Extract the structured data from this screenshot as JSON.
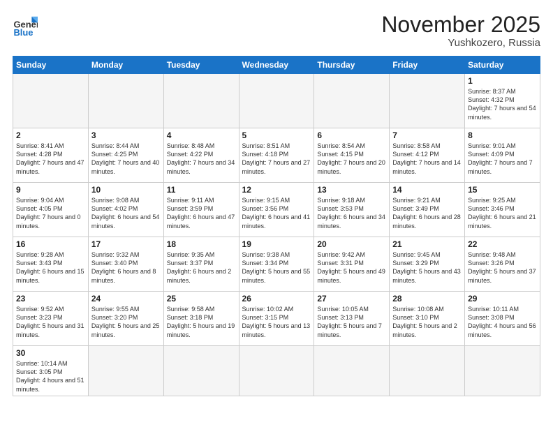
{
  "header": {
    "logo_general": "General",
    "logo_blue": "Blue",
    "month_title": "November 2025",
    "location": "Yushkozero, Russia"
  },
  "weekdays": [
    "Sunday",
    "Monday",
    "Tuesday",
    "Wednesday",
    "Thursday",
    "Friday",
    "Saturday"
  ],
  "weeks": [
    [
      {
        "day": "",
        "info": ""
      },
      {
        "day": "",
        "info": ""
      },
      {
        "day": "",
        "info": ""
      },
      {
        "day": "",
        "info": ""
      },
      {
        "day": "",
        "info": ""
      },
      {
        "day": "",
        "info": ""
      },
      {
        "day": "1",
        "info": "Sunrise: 8:37 AM\nSunset: 4:32 PM\nDaylight: 7 hours\nand 54 minutes."
      }
    ],
    [
      {
        "day": "2",
        "info": "Sunrise: 8:41 AM\nSunset: 4:28 PM\nDaylight: 7 hours\nand 47 minutes."
      },
      {
        "day": "3",
        "info": "Sunrise: 8:44 AM\nSunset: 4:25 PM\nDaylight: 7 hours\nand 40 minutes."
      },
      {
        "day": "4",
        "info": "Sunrise: 8:48 AM\nSunset: 4:22 PM\nDaylight: 7 hours\nand 34 minutes."
      },
      {
        "day": "5",
        "info": "Sunrise: 8:51 AM\nSunset: 4:18 PM\nDaylight: 7 hours\nand 27 minutes."
      },
      {
        "day": "6",
        "info": "Sunrise: 8:54 AM\nSunset: 4:15 PM\nDaylight: 7 hours\nand 20 minutes."
      },
      {
        "day": "7",
        "info": "Sunrise: 8:58 AM\nSunset: 4:12 PM\nDaylight: 7 hours\nand 14 minutes."
      },
      {
        "day": "8",
        "info": "Sunrise: 9:01 AM\nSunset: 4:09 PM\nDaylight: 7 hours\nand 7 minutes."
      }
    ],
    [
      {
        "day": "9",
        "info": "Sunrise: 9:04 AM\nSunset: 4:05 PM\nDaylight: 7 hours\nand 0 minutes."
      },
      {
        "day": "10",
        "info": "Sunrise: 9:08 AM\nSunset: 4:02 PM\nDaylight: 6 hours\nand 54 minutes."
      },
      {
        "day": "11",
        "info": "Sunrise: 9:11 AM\nSunset: 3:59 PM\nDaylight: 6 hours\nand 47 minutes."
      },
      {
        "day": "12",
        "info": "Sunrise: 9:15 AM\nSunset: 3:56 PM\nDaylight: 6 hours\nand 41 minutes."
      },
      {
        "day": "13",
        "info": "Sunrise: 9:18 AM\nSunset: 3:53 PM\nDaylight: 6 hours\nand 34 minutes."
      },
      {
        "day": "14",
        "info": "Sunrise: 9:21 AM\nSunset: 3:49 PM\nDaylight: 6 hours\nand 28 minutes."
      },
      {
        "day": "15",
        "info": "Sunrise: 9:25 AM\nSunset: 3:46 PM\nDaylight: 6 hours\nand 21 minutes."
      }
    ],
    [
      {
        "day": "16",
        "info": "Sunrise: 9:28 AM\nSunset: 3:43 PM\nDaylight: 6 hours\nand 15 minutes."
      },
      {
        "day": "17",
        "info": "Sunrise: 9:32 AM\nSunset: 3:40 PM\nDaylight: 6 hours\nand 8 minutes."
      },
      {
        "day": "18",
        "info": "Sunrise: 9:35 AM\nSunset: 3:37 PM\nDaylight: 6 hours\nand 2 minutes."
      },
      {
        "day": "19",
        "info": "Sunrise: 9:38 AM\nSunset: 3:34 PM\nDaylight: 5 hours\nand 55 minutes."
      },
      {
        "day": "20",
        "info": "Sunrise: 9:42 AM\nSunset: 3:31 PM\nDaylight: 5 hours\nand 49 minutes."
      },
      {
        "day": "21",
        "info": "Sunrise: 9:45 AM\nSunset: 3:29 PM\nDaylight: 5 hours\nand 43 minutes."
      },
      {
        "day": "22",
        "info": "Sunrise: 9:48 AM\nSunset: 3:26 PM\nDaylight: 5 hours\nand 37 minutes."
      }
    ],
    [
      {
        "day": "23",
        "info": "Sunrise: 9:52 AM\nSunset: 3:23 PM\nDaylight: 5 hours\nand 31 minutes."
      },
      {
        "day": "24",
        "info": "Sunrise: 9:55 AM\nSunset: 3:20 PM\nDaylight: 5 hours\nand 25 minutes."
      },
      {
        "day": "25",
        "info": "Sunrise: 9:58 AM\nSunset: 3:18 PM\nDaylight: 5 hours\nand 19 minutes."
      },
      {
        "day": "26",
        "info": "Sunrise: 10:02 AM\nSunset: 3:15 PM\nDaylight: 5 hours\nand 13 minutes."
      },
      {
        "day": "27",
        "info": "Sunrise: 10:05 AM\nSunset: 3:13 PM\nDaylight: 5 hours\nand 7 minutes."
      },
      {
        "day": "28",
        "info": "Sunrise: 10:08 AM\nSunset: 3:10 PM\nDaylight: 5 hours\nand 2 minutes."
      },
      {
        "day": "29",
        "info": "Sunrise: 10:11 AM\nSunset: 3:08 PM\nDaylight: 4 hours\nand 56 minutes."
      }
    ],
    [
      {
        "day": "30",
        "info": "Sunrise: 10:14 AM\nSunset: 3:05 PM\nDaylight: 4 hours\nand 51 minutes."
      },
      {
        "day": "",
        "info": ""
      },
      {
        "day": "",
        "info": ""
      },
      {
        "day": "",
        "info": ""
      },
      {
        "day": "",
        "info": ""
      },
      {
        "day": "",
        "info": ""
      },
      {
        "day": "",
        "info": ""
      }
    ]
  ]
}
